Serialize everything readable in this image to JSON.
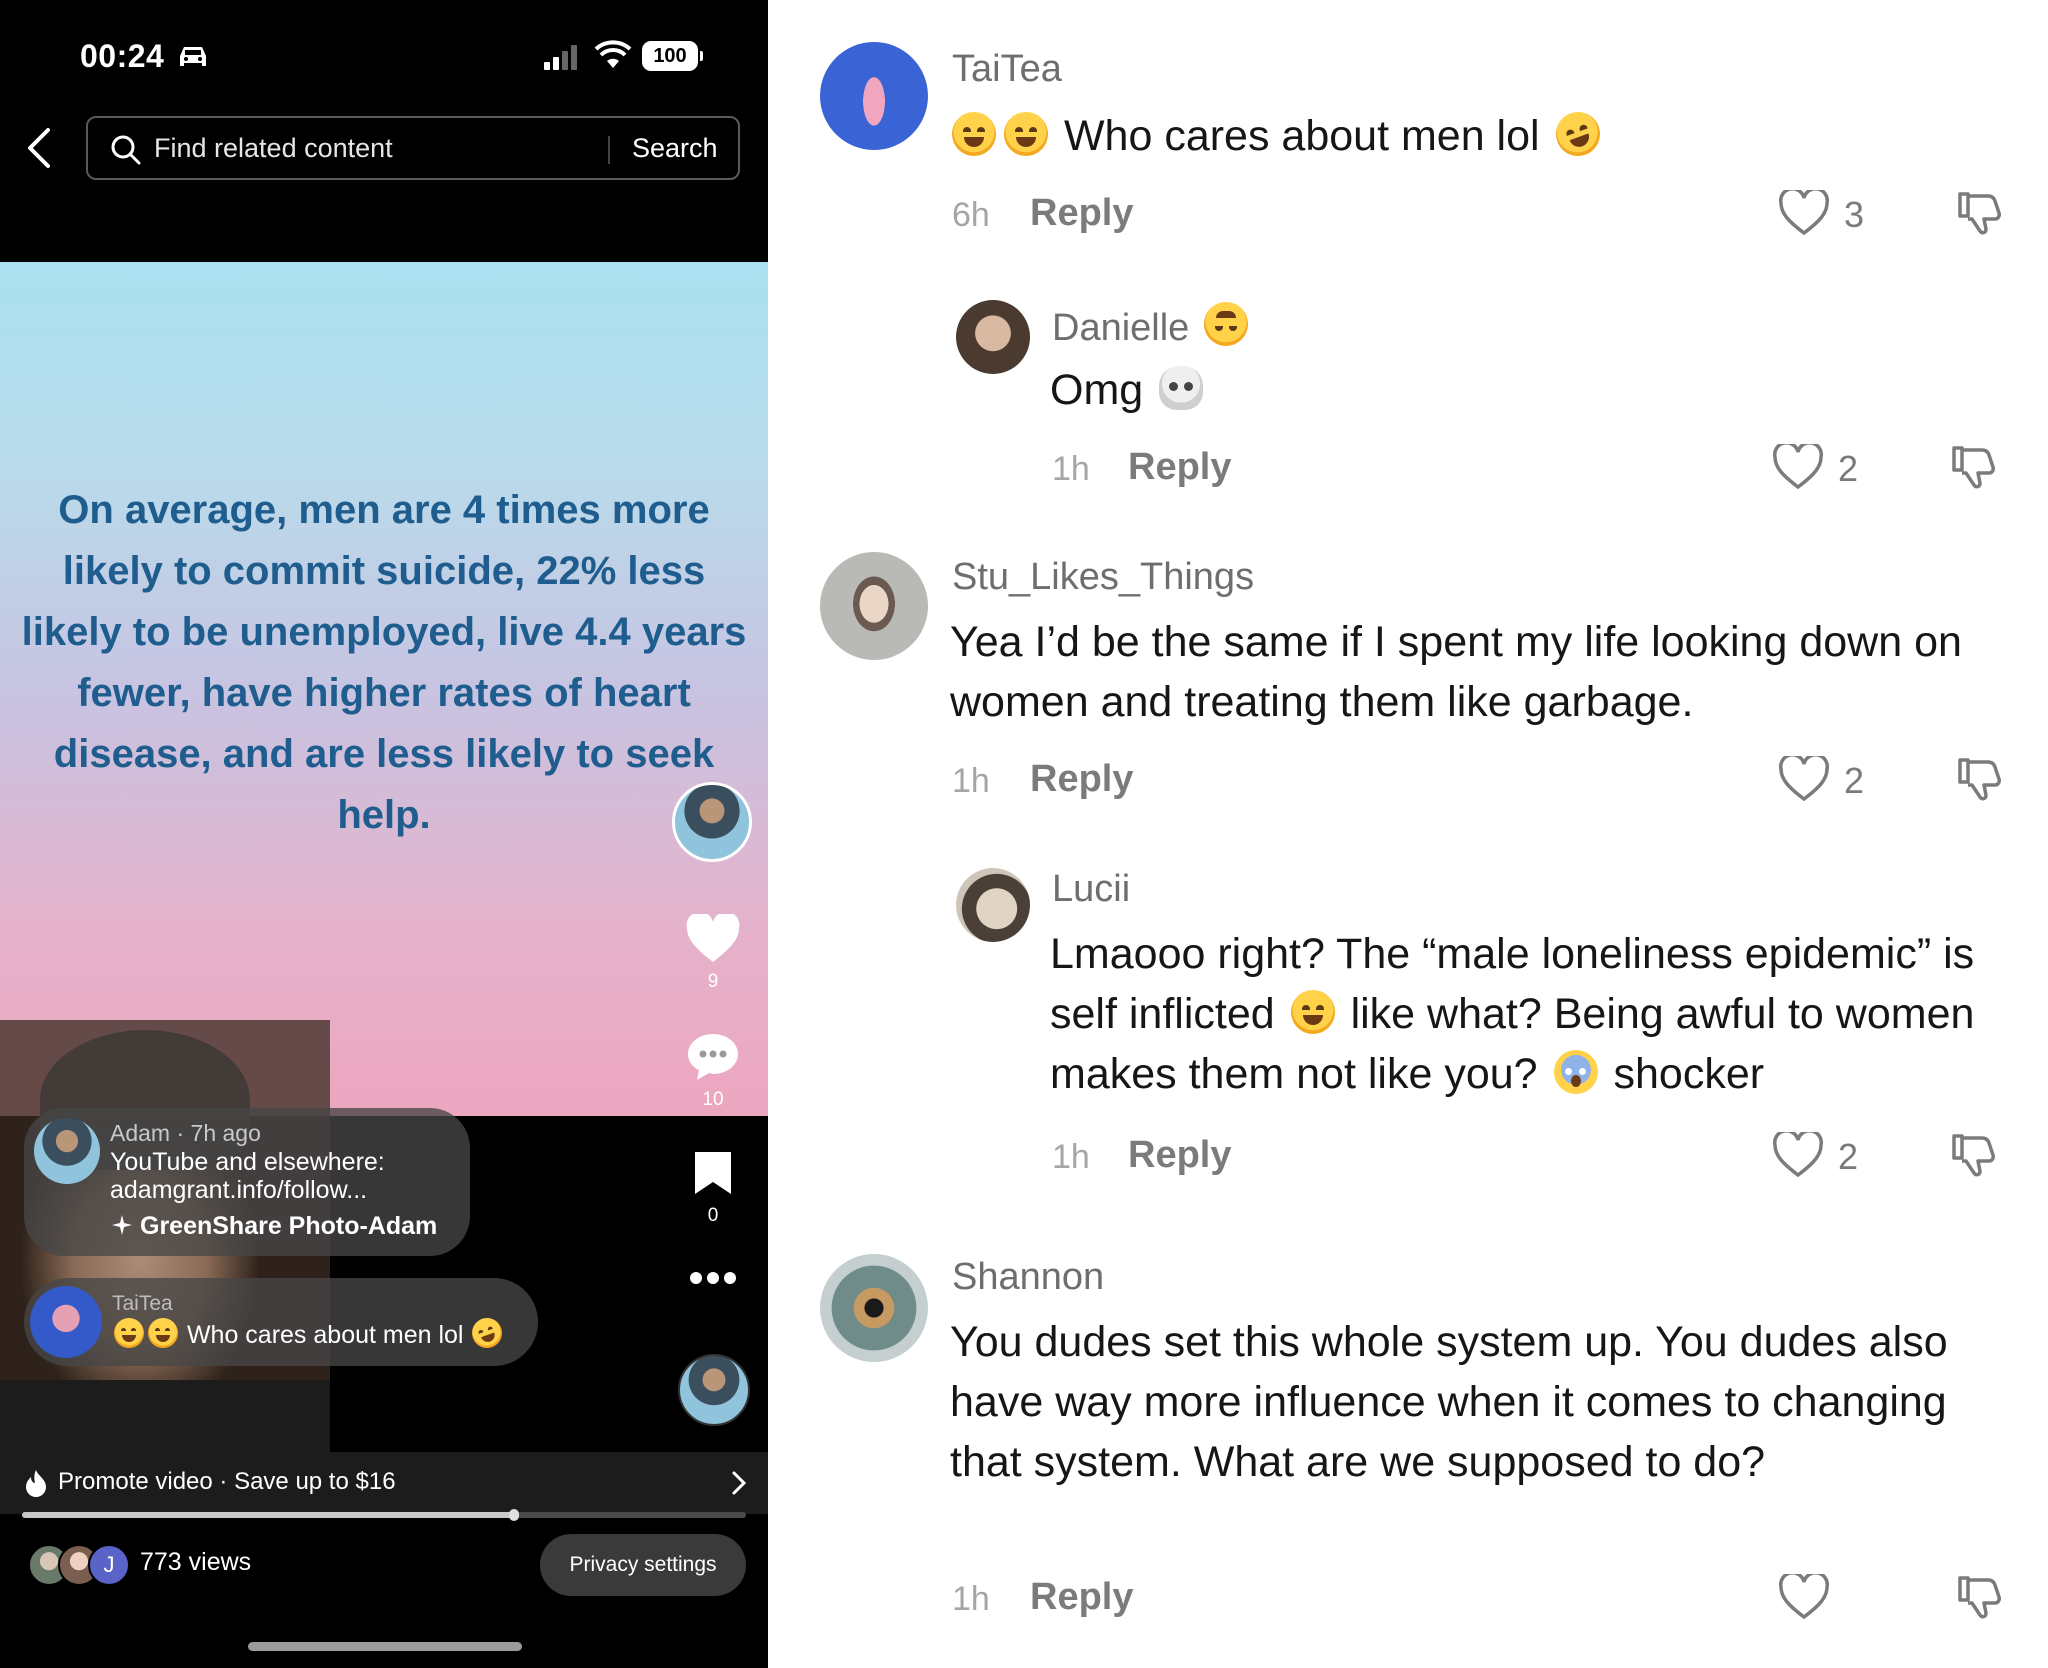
{
  "status_bar": {
    "time": "00:24",
    "battery": "100"
  },
  "search": {
    "placeholder": "Find related content",
    "button_label": "Search"
  },
  "video": {
    "overlay_text": "On average, men are 4 times more likely to commit suicide, 22% less likely to be unemployed, live 4.4 years fewer, have higher rates of heart disease, and are less likely to seek help."
  },
  "side_actions": {
    "likes": "9",
    "comments": "10",
    "saves": "0"
  },
  "description": {
    "meta": "Adam · 7h ago",
    "text": "YouTube and elsewhere: adamgrant.info/follow...",
    "effect": "GreenShare Photo-Adam"
  },
  "comment_preview": {
    "user": "TaiTea",
    "text": "Who cares about men lol"
  },
  "promote": {
    "text": "Promote video · Save up to $16"
  },
  "progress": {
    "fraction": 0.68
  },
  "footer": {
    "viewer_initial": "J",
    "views": "773 views",
    "privacy_label": "Privacy settings"
  },
  "comments": [
    {
      "user": "TaiTea",
      "text": "Who cares about men lol",
      "time": "6h",
      "reply_label": "Reply",
      "likes": "3",
      "emojis": [
        "sweat-smile-emoji",
        "sweat-smile-emoji",
        "rofl-emoji"
      ]
    },
    {
      "user": "Danielle",
      "text": "Omg",
      "time": "1h",
      "reply_label": "Reply",
      "likes": "2",
      "emojis": [
        "upside-down-face-emoji",
        "skull-emoji"
      ]
    },
    {
      "user": "Stu_Likes_Things",
      "text": "Yea I’d be the same if I spent my life looking down on women and treating them like garbage.",
      "time": "1h",
      "reply_label": "Reply",
      "likes": "2"
    },
    {
      "user": "Lucii",
      "text_parts": [
        "Lmaooo right? The “male loneliness epidemic” is self inflicted",
        "like what? Being awful to women makes them not like you?",
        "shocker"
      ],
      "time": "1h",
      "reply_label": "Reply",
      "likes": "2",
      "emojis": [
        "joy-emoji",
        "scream-emoji"
      ]
    },
    {
      "user": "Shannon",
      "text": "You dudes set this whole system up. You dudes also have way more influence when it comes to changing that system. What are we supposed to do?",
      "time": "1h",
      "reply_label": "Reply",
      "likes": ""
    }
  ],
  "colors": {
    "video_text": "#1e5d8e",
    "username": "#6e6e6e",
    "muted": "#a5a5a5"
  },
  "icons": [
    "car-icon",
    "signal-icon",
    "wifi-icon",
    "back-arrow-icon",
    "search-icon",
    "heart-icon",
    "comment-icon",
    "bookmark-icon",
    "more-icon",
    "fire-icon",
    "chevron-right-icon",
    "dislike-icon"
  ]
}
